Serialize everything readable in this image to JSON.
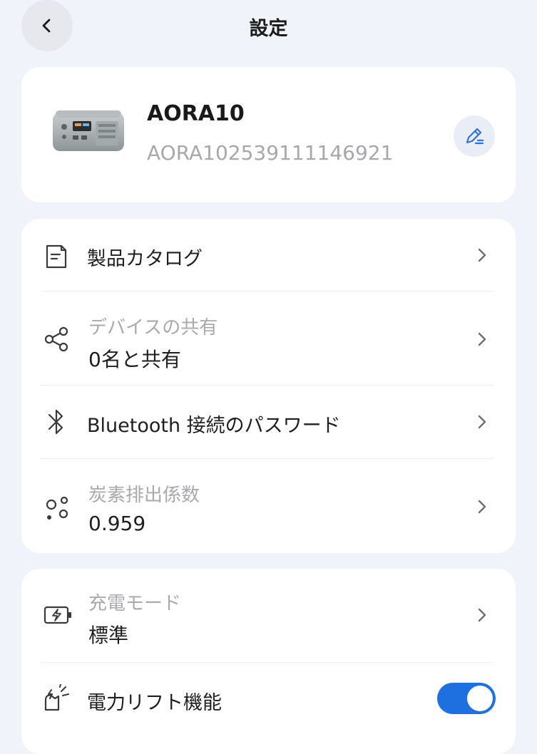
{
  "header": {
    "title": "設定"
  },
  "device": {
    "name": "AORA10",
    "serial": "AORA102539111146921"
  },
  "settings": {
    "catalog": {
      "label": "製品カタログ"
    },
    "share": {
      "label": "デバイスの共有",
      "value": "0名と共有"
    },
    "bluetooth": {
      "label": "Bluetooth 接続のパスワード"
    },
    "carbon": {
      "label": "炭素排出係数",
      "value": "0.959"
    }
  },
  "mode": {
    "charge": {
      "label": "充電モード",
      "value": "標準"
    },
    "power_lift": {
      "label": "電力リフト機能",
      "enabled": true
    }
  },
  "colors": {
    "accent": "#1e6fe0",
    "background": "#f1f3fa"
  }
}
